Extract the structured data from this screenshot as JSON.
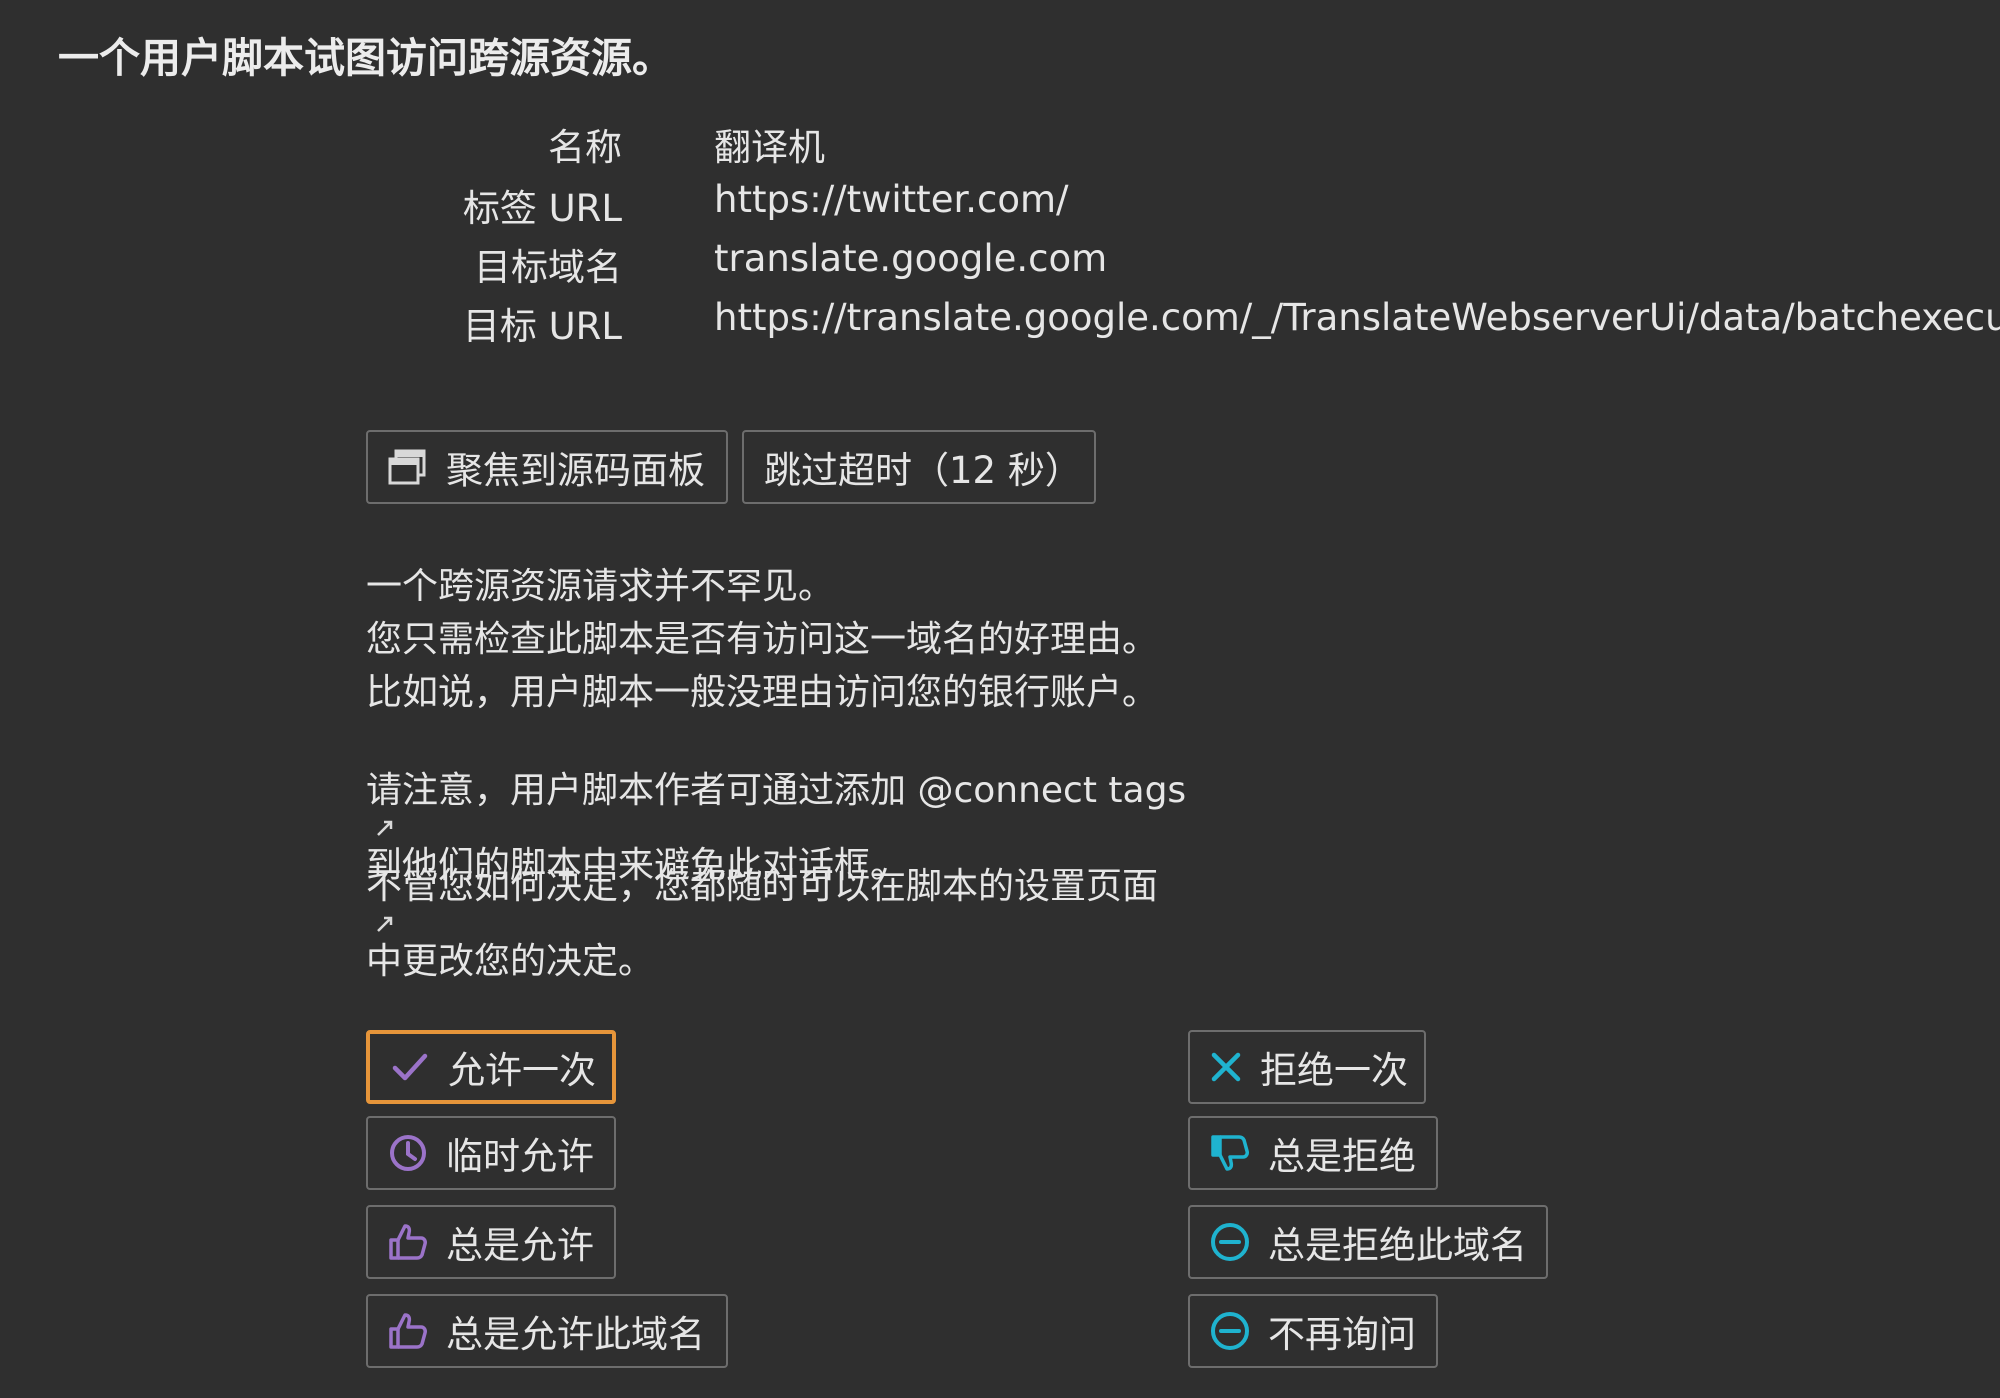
{
  "dialog": {
    "title": "一个用户脚本试图访问跨源资源。",
    "info": {
      "name_label": "名称",
      "name_value": "翻译机",
      "tab_url_label": "标签 URL",
      "tab_url_value": "https://twitter.com/",
      "target_domain_label": "目标域名",
      "target_domain_value": "translate.google.com",
      "target_url_label": "目标 URL",
      "target_url_value": "https://translate.google.com/_/TranslateWebserverUi/data/batchexecute"
    },
    "toolbar": {
      "focus_label": "聚焦到源码面板",
      "skip_timeout_label": "跳过超时（12 秒）"
    },
    "explanation": {
      "line1": "一个跨源资源请求并不罕见。",
      "line2": "您只需检查此脚本是否有访问这一域名的好理由。",
      "line3": "比如说，用户脚本一般没理由访问您的银行账户。",
      "note_prefix": "请注意，用户脚本作者可通过添加 ",
      "note_link": "@connect tags",
      "note_suffix": " 到他们的脚本中来避免此对话框。",
      "settings_prefix": "不管您如何决定，您都随时可以在脚本的",
      "settings_link": "设置页面",
      "settings_suffix": "中更改您的决定。"
    },
    "actions": {
      "allow_once": "允许一次",
      "temp_allow": "临时允许",
      "always_allow": "总是允许",
      "always_allow_domain": "总是允许此域名",
      "deny_once": "拒绝一次",
      "always_deny": "总是拒绝",
      "always_deny_domain": "总是拒绝此域名",
      "never_ask": "不再询问"
    },
    "icons": {
      "focus": "window-icon",
      "allow_once": "check-icon",
      "temp_allow": "clock-icon",
      "always_allow": "thumbs-up-icon",
      "always_allow_domain": "thumbs-up-icon",
      "deny_once": "close-icon",
      "always_deny": "thumbs-down-icon",
      "always_deny_domain": "minus-circle-icon",
      "never_ask": "minus-circle-icon",
      "external_link": "external-link-icon"
    },
    "colors": {
      "background": "#2f2f2f",
      "text": "#e6e6e6",
      "focus_border": "#e6953a",
      "allow_icon": "#9b73c9",
      "deny_icon": "#1fb3cf",
      "button_border": "#6d6d6d"
    }
  }
}
